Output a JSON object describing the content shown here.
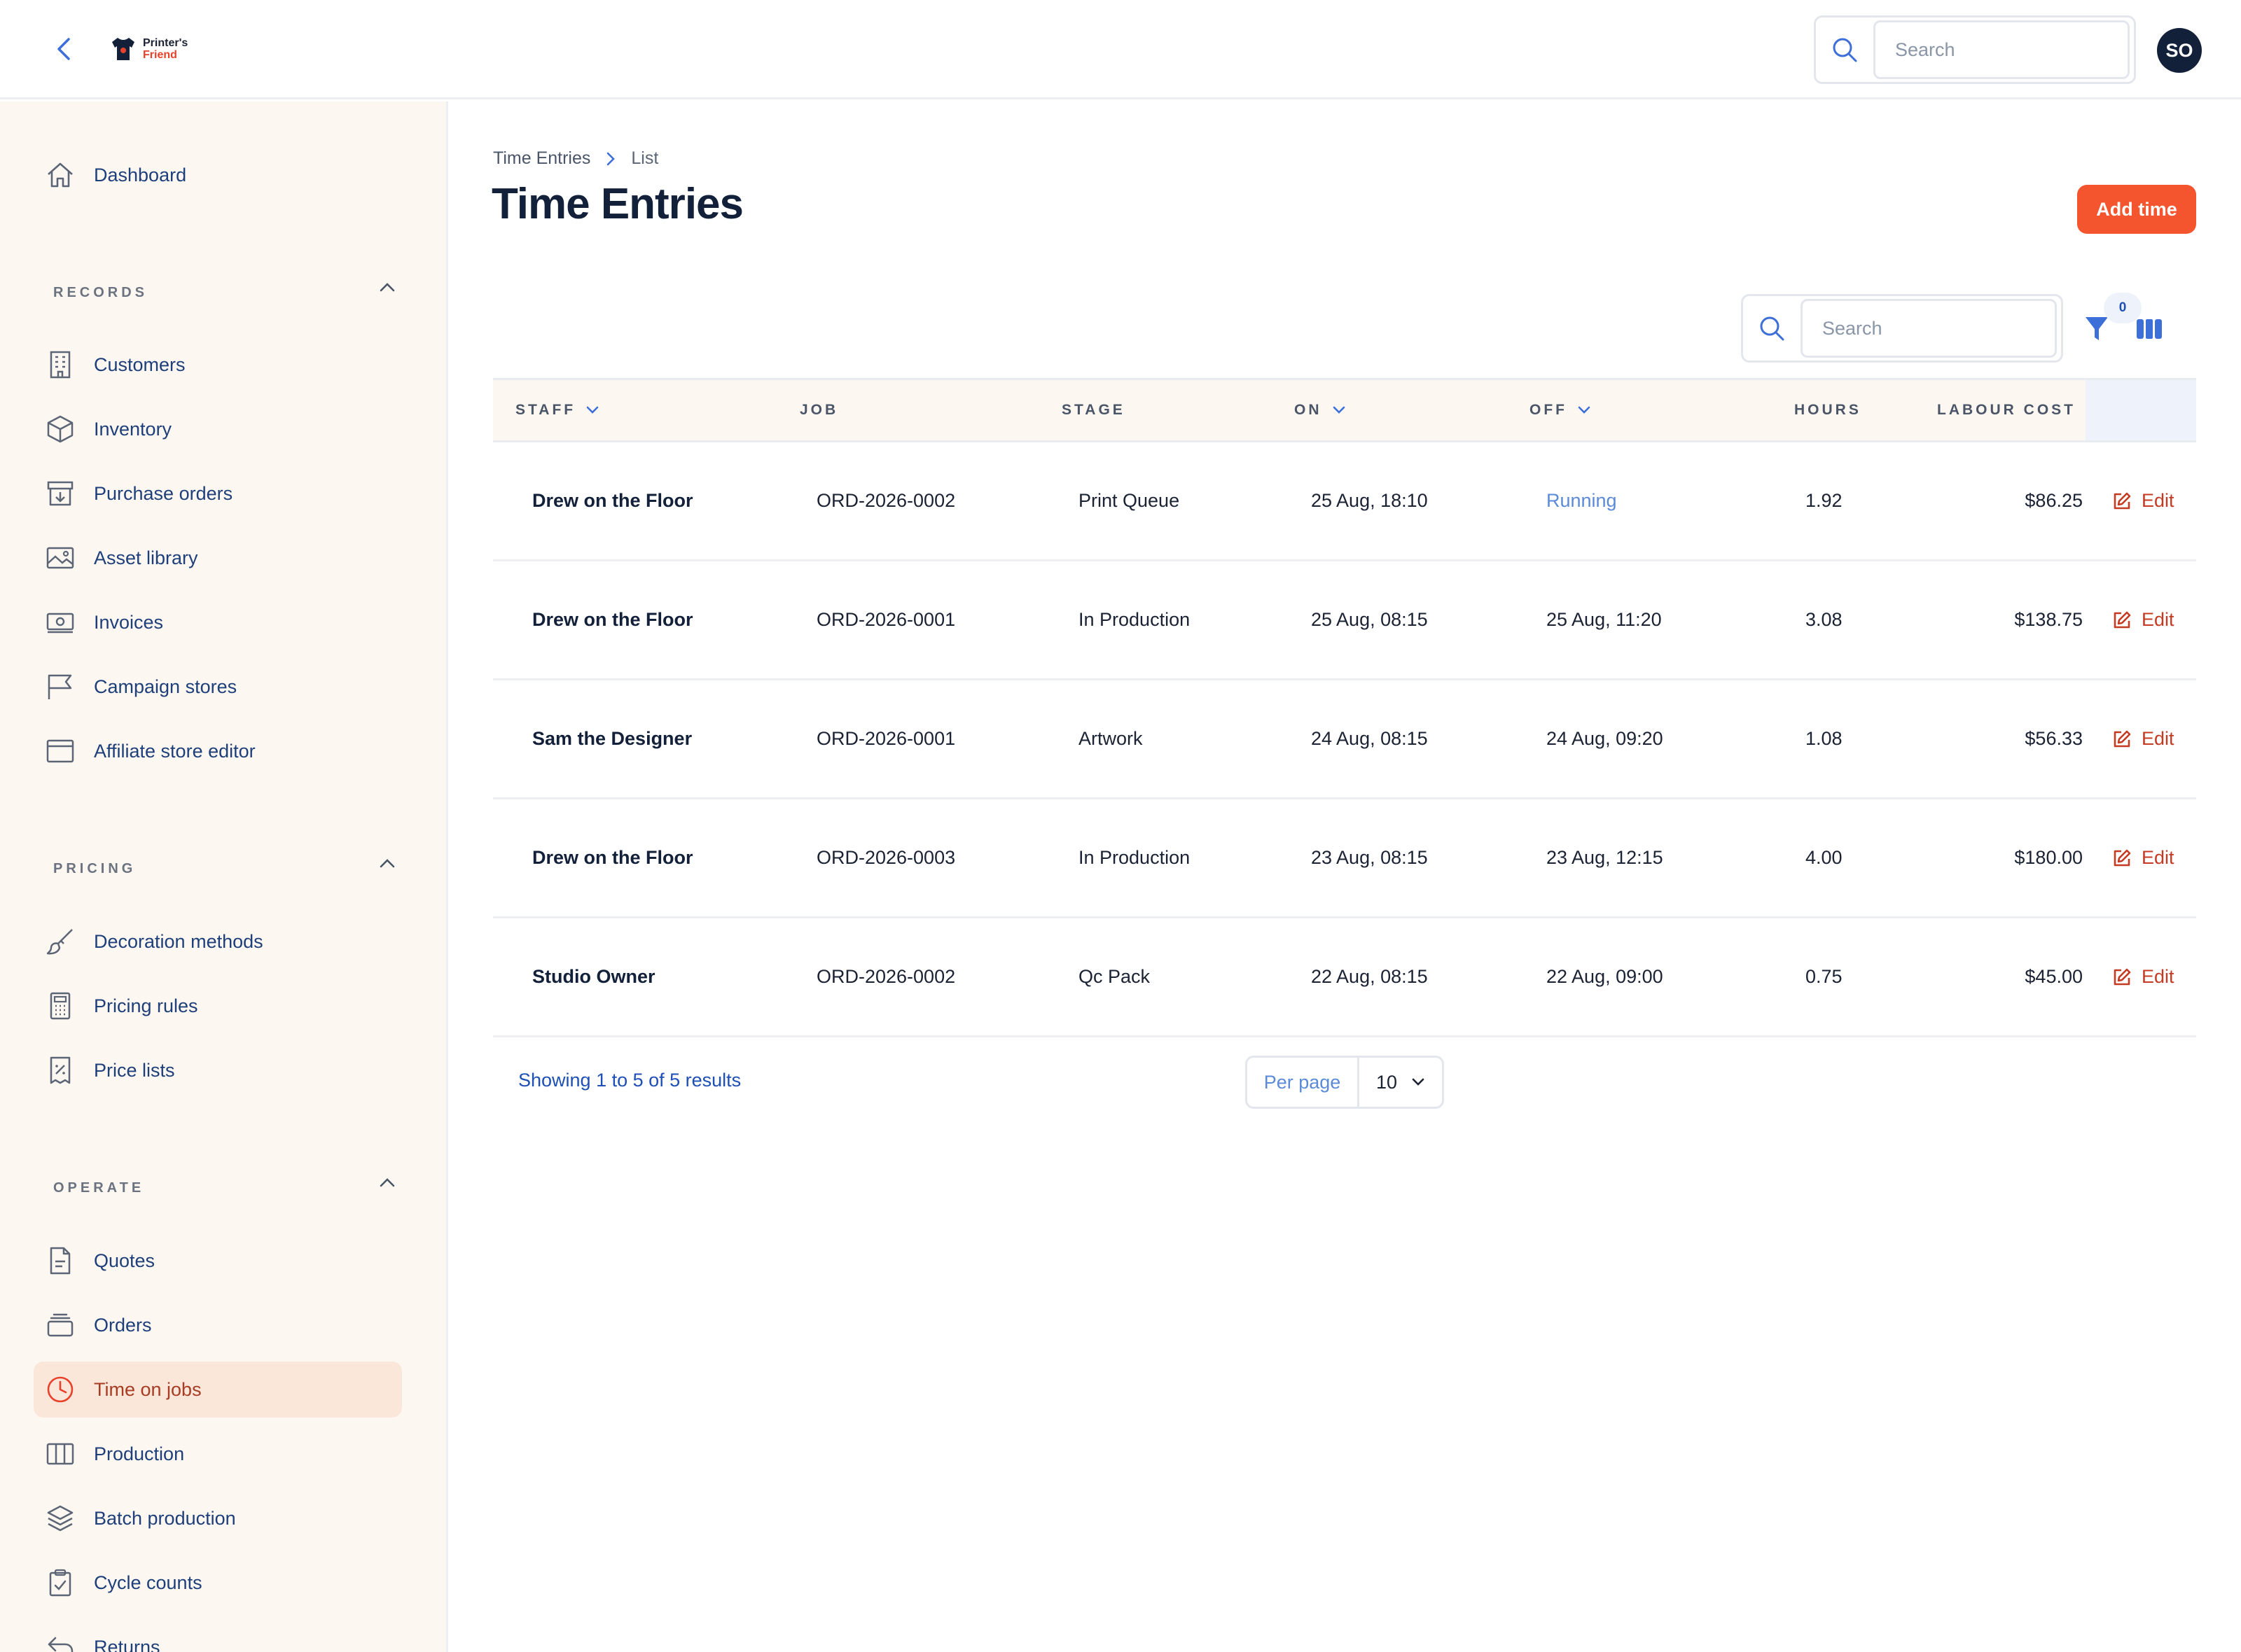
{
  "app": {
    "logo_line1": "Printer's",
    "logo_line2": "Friend",
    "search_placeholder": "Search",
    "avatar_initials": "SO"
  },
  "sidebar": {
    "dashboard": "Dashboard",
    "records_title": "RECORDS",
    "records": [
      "Customers",
      "Inventory",
      "Purchase orders",
      "Asset library",
      "Invoices",
      "Campaign stores",
      "Affiliate store editor"
    ],
    "pricing_title": "PRICING",
    "pricing": [
      "Decoration methods",
      "Pricing rules",
      "Price lists"
    ],
    "operate_title": "OPERATE",
    "operate": [
      "Quotes",
      "Orders",
      "Time on jobs",
      "Production",
      "Batch production",
      "Cycle counts",
      "Returns"
    ]
  },
  "breadcrumb": {
    "parent": "Time Entries",
    "current": "List"
  },
  "page": {
    "title": "Time Entries",
    "add_button": "Add time"
  },
  "table": {
    "search_placeholder": "Search",
    "filter_count": "0",
    "columns": [
      "STAFF",
      "JOB",
      "STAGE",
      "ON",
      "OFF",
      "HOURS",
      "LABOUR COST"
    ],
    "edit_label": "Edit",
    "rows": [
      {
        "staff": "Drew on the Floor",
        "job": "ORD-2026-0002",
        "stage": "Print Queue",
        "on": "25 Aug, 18:10",
        "off": "Running",
        "hours": "1.92",
        "cost": "$86.25"
      },
      {
        "staff": "Drew on the Floor",
        "job": "ORD-2026-0001",
        "stage": "In Production",
        "on": "25 Aug, 08:15",
        "off": "25 Aug, 11:20",
        "hours": "3.08",
        "cost": "$138.75"
      },
      {
        "staff": "Sam the Designer",
        "job": "ORD-2026-0001",
        "stage": "Artwork",
        "on": "24 Aug, 08:15",
        "off": "24 Aug, 09:20",
        "hours": "1.08",
        "cost": "$56.33"
      },
      {
        "staff": "Drew on the Floor",
        "job": "ORD-2026-0003",
        "stage": "In Production",
        "on": "23 Aug, 08:15",
        "off": "23 Aug, 12:15",
        "hours": "4.00",
        "cost": "$180.00"
      },
      {
        "staff": "Studio Owner",
        "job": "ORD-2026-0002",
        "stage": "Qc Pack",
        "on": "22 Aug, 08:15",
        "off": "22 Aug, 09:00",
        "hours": "0.75",
        "cost": "$45.00"
      }
    ]
  },
  "pagination": {
    "summary": "Showing 1 to 5 of 5 results",
    "per_page_label": "Per page",
    "per_page_value": "10"
  },
  "colors": {
    "accent": "#f4552f",
    "link": "#1e4fb5",
    "sidebar_bg": "#fcf7f1",
    "active_bg": "#fbe6da"
  }
}
